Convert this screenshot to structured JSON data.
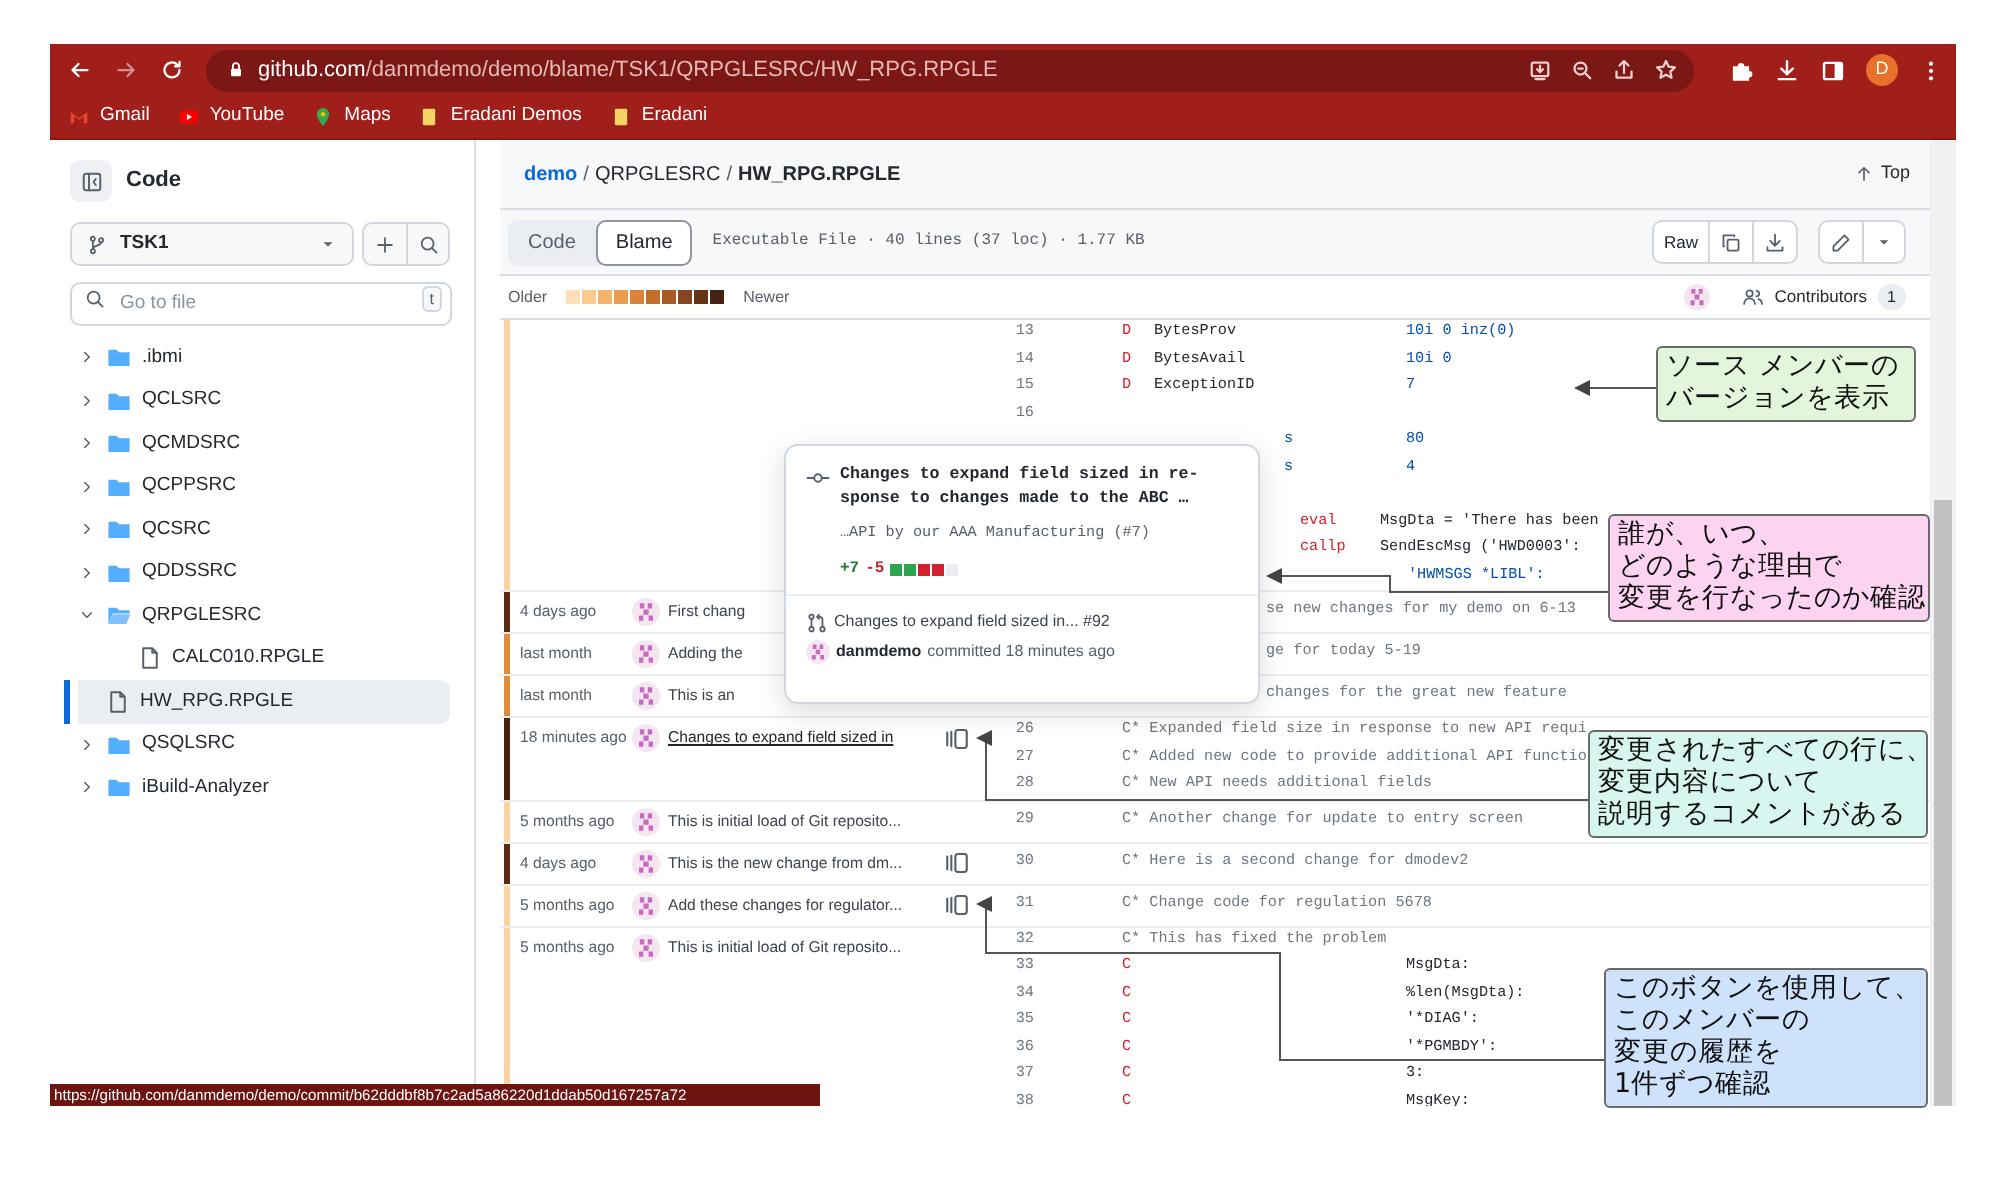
{
  "browser": {
    "url_host": "github.com",
    "url_path": "/danmdemo/demo/blame/TSK1/QRPGLESRC/HW_RPG.RPGLE",
    "profile_initial": "D",
    "bookmarks": [
      {
        "label": "Gmail",
        "kind": "gmail"
      },
      {
        "label": "YouTube",
        "kind": "youtube"
      },
      {
        "label": "Maps",
        "kind": "maps"
      },
      {
        "label": "Eradani Demos",
        "kind": "bookmark"
      },
      {
        "label": "Eradani",
        "kind": "bookmark"
      }
    ],
    "status_url": "https://github.com/danmdemo/demo/commit/b62dddbf8b7c2ad5a86220d1ddab50d167257a72"
  },
  "sidebar": {
    "title": "Code",
    "branch": "TSK1",
    "search": {
      "placeholder": "Go to file",
      "shortcut": "t"
    },
    "tree": [
      {
        "label": ".ibmi",
        "kind": "folder",
        "expanded": false,
        "selected": false
      },
      {
        "label": "QCLSRC",
        "kind": "folder",
        "expanded": false,
        "selected": false
      },
      {
        "label": "QCMDSRC",
        "kind": "folder",
        "expanded": false,
        "selected": false
      },
      {
        "label": "QCPPSRC",
        "kind": "folder",
        "expanded": false,
        "selected": false
      },
      {
        "label": "QCSRC",
        "kind": "folder",
        "expanded": false,
        "selected": false
      },
      {
        "label": "QDDSSRC",
        "kind": "folder",
        "expanded": false,
        "selected": false
      },
      {
        "label": "QRPGLESRC",
        "kind": "folder",
        "expanded": true,
        "selected": false,
        "children": [
          {
            "label": "CALC010.RPGLE",
            "kind": "file",
            "selected": false
          },
          {
            "label": "HW_RPG.RPGLE",
            "kind": "file",
            "selected": true
          }
        ]
      },
      {
        "label": "QSQLSRC",
        "kind": "folder",
        "expanded": false,
        "selected": false
      },
      {
        "label": "iBuild-Analyzer",
        "kind": "folder",
        "expanded": false,
        "selected": false
      }
    ]
  },
  "breadcrumb": {
    "separator": "/",
    "items": [
      {
        "label": "demo",
        "kind": "repo"
      },
      {
        "label": "QRPGLESRC",
        "kind": "folder"
      },
      {
        "label": "HW_RPG.RPGLE",
        "kind": "file"
      }
    ]
  },
  "top_link": "Top",
  "view_tabs": [
    {
      "label": "Code",
      "selected": false
    },
    {
      "label": "Blame",
      "selected": true
    }
  ],
  "file_info": "Executable File · 40 lines (37 loc) · 1.77 KB",
  "raw_button": "Raw",
  "legend": {
    "older": "Older",
    "newer": "Newer",
    "scale": [
      {
        "color": "#ffdfb6"
      },
      {
        "color": "#fbca8e"
      },
      {
        "color": "#f4b26c"
      },
      {
        "color": "#e99b4e"
      },
      {
        "color": "#d9843a"
      },
      {
        "color": "#c46e2c"
      },
      {
        "color": "#a75a24"
      },
      {
        "color": "#87471d"
      },
      {
        "color": "#663516"
      },
      {
        "color": "#45230f"
      }
    ]
  },
  "contributors": {
    "label": "Contributors",
    "count": "1"
  },
  "blame": [
    {
      "color": "#fbd3a2",
      "lines": [
        {
          "kind": "decl",
          "number": "13",
          "spec": "D",
          "name": "BytesProv",
          "value": "10i 0 inz(0)"
        },
        {
          "kind": "decl",
          "number": "14",
          "spec": "D",
          "name": "BytesAvail",
          "value": "10i 0"
        },
        {
          "kind": "decl",
          "number": "15",
          "spec": "D",
          "name": "ExceptionID",
          "value": "7"
        },
        {
          "kind": "blank",
          "number": "16"
        },
        {
          "kind": "decl",
          "type": "s",
          "value": "80"
        },
        {
          "kind": "decl",
          "type": "s",
          "value": "4"
        },
        {
          "kind": "hidden"
        },
        {
          "kind": "calc",
          "opcode": "eval",
          "expr": "MsgDta = 'There has been"
        },
        {
          "kind": "calc",
          "opcode": "callp",
          "expr": "SendEscMsg ('HWD0003':"
        },
        {
          "kind": "cont",
          "expr": "'HWMSGS    *LIBL':"
        }
      ]
    },
    {
      "date": "4 days ago",
      "message": "First chang",
      "color": "#5a2a10",
      "history": false,
      "link": false,
      "lines": [
        {
          "kind": "tail",
          "text": "se new changes for my demo on 6-13"
        }
      ]
    },
    {
      "date": "last month",
      "message": "Adding the",
      "color": "#e38b3c",
      "history": false,
      "link": false,
      "lines": [
        {
          "kind": "tail",
          "text": "ge for today 5-19"
        }
      ]
    },
    {
      "date": "last month",
      "message": "This is an",
      "color": "#e38b3c",
      "history": false,
      "link": false,
      "lines": [
        {
          "kind": "tail",
          "text": "changes for the great new feature"
        }
      ]
    },
    {
      "date": "18 minutes ago",
      "message": "Changes to expand field sized in",
      "color": "#45230f",
      "history": true,
      "link": true,
      "lines": [
        {
          "kind": "comment",
          "number": "26",
          "text": "C* Expanded field size in response to new API requi"
        },
        {
          "kind": "comment",
          "number": "27",
          "text": "C* Added new code to provide additional API functio"
        },
        {
          "kind": "comment",
          "number": "28",
          "text": "C* New API needs additional fields"
        }
      ]
    },
    {
      "date": "5 months ago",
      "message": "This is initial load of Git reposito...",
      "color": "#fbd3a2",
      "history": false,
      "link": false,
      "lines": [
        {
          "kind": "comment",
          "number": "29",
          "text": "C* Another change for update to entry screen"
        }
      ]
    },
    {
      "date": "4 days ago",
      "message": "This is the new change from dm...",
      "color": "#5a2a10",
      "history": true,
      "link": false,
      "lines": [
        {
          "kind": "comment",
          "number": "30",
          "text": "C* Here is a second change for dmodev2"
        }
      ]
    },
    {
      "date": "5 months ago",
      "message": "Add these changes for regulator...",
      "color": "#fbd3a2",
      "history": true,
      "link": false,
      "lines": [
        {
          "kind": "comment",
          "number": "31",
          "text": "C* Change code for regulation 5678"
        }
      ]
    },
    {
      "date": "5 months ago",
      "message": "This is initial load of Git reposito...",
      "color": "#fbd3a2",
      "history": false,
      "link": false,
      "lines": [
        {
          "kind": "comment",
          "number": "32",
          "text": "C* This has fixed the problem"
        },
        {
          "kind": "cspec",
          "number": "33",
          "spec": "C",
          "value": "MsgDta:"
        },
        {
          "kind": "cspec",
          "number": "34",
          "spec": "C",
          "value": "%len(MsgDta):"
        },
        {
          "kind": "cspec",
          "number": "35",
          "spec": "C",
          "value": "'*DIAG':"
        },
        {
          "kind": "cspec",
          "number": "36",
          "spec": "C",
          "value": "'*PGMBDY':"
        },
        {
          "kind": "cspec",
          "number": "37",
          "spec": "C",
          "value": "3:"
        },
        {
          "kind": "cspec",
          "number": "38",
          "spec": "C",
          "value": "MsgKey:"
        }
      ]
    }
  ],
  "popup": {
    "title_lines": [
      "Changes to expand field sized in re-",
      "sponse to changes made to the ABC …"
    ],
    "body": "…API by our AAA Manufacturing (",
    "body_link": "#7",
    "body_end": ")",
    "additions": "+7",
    "deletions": "-5",
    "blocks": [
      {
        "kind": "added"
      },
      {
        "kind": "added"
      },
      {
        "kind": "removed"
      },
      {
        "kind": "removed"
      },
      {
        "kind": "neutral"
      }
    ],
    "pr_title": "Changes to expand field sized in...",
    "pr_number": "#92",
    "author": "danmdemo",
    "committed": "committed 18 minutes ago"
  },
  "callouts": [
    {
      "lines": [
        "ソース メンバーの",
        "バージョンを表示"
      ],
      "color": "#e3f5da"
    },
    {
      "lines": [
        "誰が、いつ、",
        "どのような理由で",
        "変更を行なったのか確認"
      ],
      "color": "#fdd3f2"
    },
    {
      "lines": [
        "変更されたすべての行に、",
        "変更内容について",
        "説明するコメントがある"
      ],
      "color": "#d7f6ef"
    },
    {
      "lines": [
        "このボタンを使用して、",
        "このメンバーの",
        "変更の履歴を",
        "1件ずつ確認"
      ],
      "color": "#cfe2fc"
    }
  ]
}
